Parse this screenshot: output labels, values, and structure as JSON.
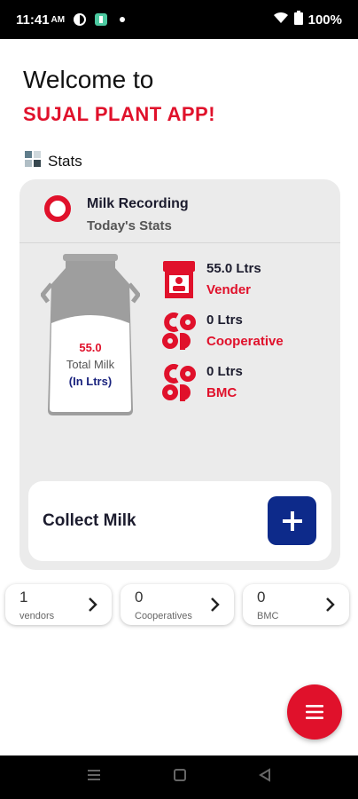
{
  "status_bar": {
    "time": "11:41",
    "ampm": "AM",
    "battery": "100%"
  },
  "header": {
    "welcome": "Welcome to",
    "app_name": "SUJAL PLANT APP!"
  },
  "stats_section": {
    "title": "Stats"
  },
  "milk_card": {
    "title": "Milk Recording",
    "subtitle": "Today's Stats",
    "total_value": "55.0",
    "total_label": "Total Milk",
    "total_unit": "(In Ltrs)",
    "rows": [
      {
        "value": "55.0 Ltrs",
        "label": "Vender",
        "icon": "vendor-shop-icon"
      },
      {
        "value": "0 Ltrs",
        "label": "Cooperative",
        "icon": "coop-icon"
      },
      {
        "value": "0 Ltrs",
        "label": "BMC",
        "icon": "coop-icon"
      }
    ],
    "collect_label": "Collect Milk"
  },
  "summary": [
    {
      "count": "1",
      "label": "vendors"
    },
    {
      "count": "0",
      "label": "Cooperatives"
    },
    {
      "count": "0",
      "label": "BMC"
    }
  ],
  "colors": {
    "accent_red": "#e0112b",
    "navy": "#0d2a8a",
    "card_bg": "#ebebeb"
  }
}
